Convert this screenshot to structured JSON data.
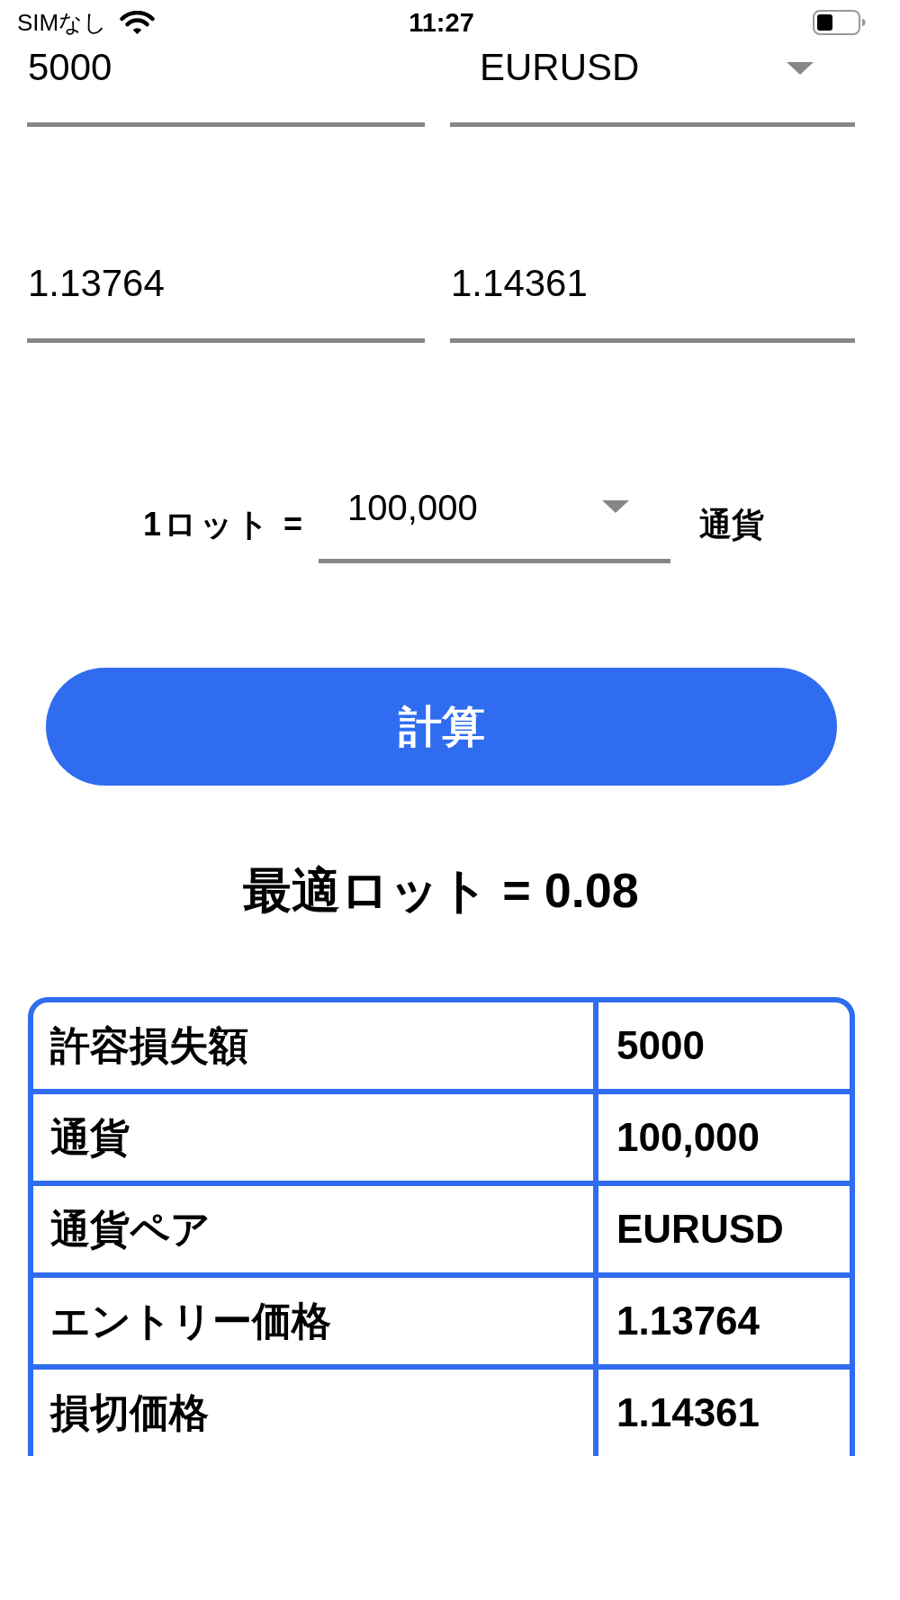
{
  "status_bar": {
    "carrier": "SIMなし",
    "time": "11:27"
  },
  "fields": [
    {
      "kind": "input",
      "value": "5000"
    },
    {
      "kind": "select",
      "value": "EURUSD"
    },
    {
      "kind": "input",
      "value": "1.13764"
    },
    {
      "kind": "input",
      "value": "1.14361"
    }
  ],
  "lot_row": {
    "label": "1ロット =",
    "select_value": "100,000",
    "unit": "通貨"
  },
  "calculate_button": {
    "label": "計算"
  },
  "result": "最適ロット = 0.08",
  "table": {
    "rows": [
      {
        "label": "許容損失額",
        "value": "5000"
      },
      {
        "label": "通貨",
        "value": "100,000"
      },
      {
        "label": "通貨ペア",
        "value": "EURUSD"
      },
      {
        "label": "エントリー価格",
        "value": "1.13764"
      },
      {
        "label": "損切価格",
        "value": "1.14361"
      }
    ]
  }
}
